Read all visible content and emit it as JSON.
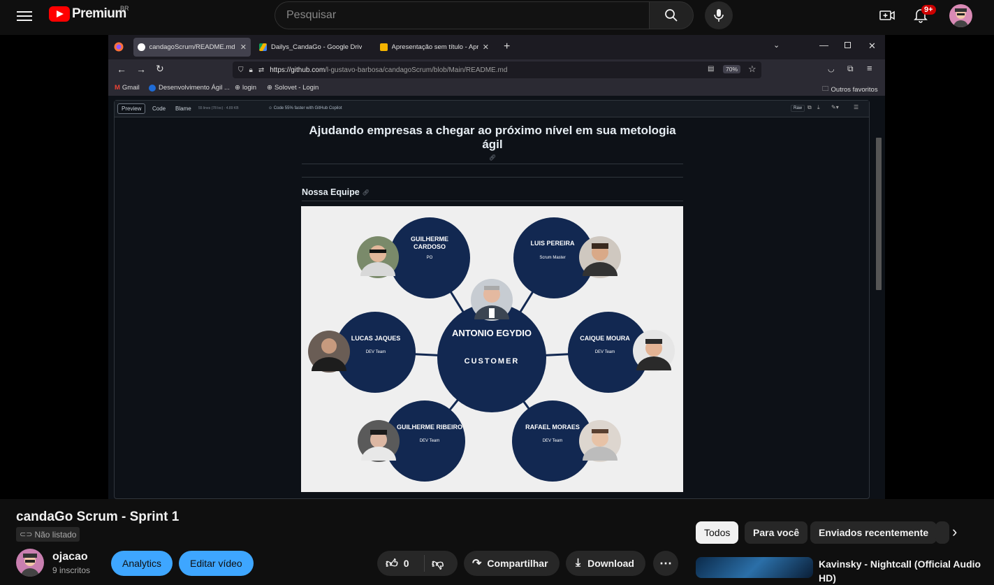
{
  "header": {
    "logo_text": "Premium",
    "region": "BR",
    "search_placeholder": "Pesquisar",
    "notifications_badge": "9+"
  },
  "browser": {
    "tabs": [
      {
        "label": "candagoScrum/README.md at"
      },
      {
        "label": "Dailys_CandaGo - Google Drive"
      },
      {
        "label": "Apresentação sem título - Apre"
      }
    ],
    "url_host": "https://github.com",
    "url_path": "/l-gustavo-barbosa/candagoScrum/blob/Main/README.md",
    "zoom": "70%",
    "bookmarks": [
      "Gmail",
      "Desenvolvimento Ágil ...",
      "login",
      "Solovet - Login"
    ],
    "other_bookmarks": "Outros favoritos"
  },
  "github": {
    "views": [
      "Preview",
      "Code",
      "Blame"
    ],
    "file_info": "55 lines (78 loc) · 4.89 KB",
    "copilot": "Code 55% faster with GitHub Copilot",
    "raw": "Raw",
    "heading": "Ajudando empresas a chegar ao próximo nível em sua metologia ágil",
    "section": "Nossa Equipe"
  },
  "team": {
    "center_name": "ANTONIO EGYDIO",
    "center_role": "CUSTOMER",
    "members": [
      {
        "name": "GUILHERME CARDOSO",
        "role": "PO"
      },
      {
        "name": "LUIS PEREIRA",
        "role": "Scrum Master"
      },
      {
        "name": "LUCAS JAQUES",
        "role": "DEV Team"
      },
      {
        "name": "CAIQUE MOURA",
        "role": "DEV Team"
      },
      {
        "name": "GUILHERME RIBEIRO",
        "role": "DEV Team"
      },
      {
        "name": "RAFAEL MORAES",
        "role": "DEV Team"
      }
    ]
  },
  "video": {
    "title": "candaGo Scrum - Sprint 1",
    "visibility": "Não listado",
    "channel": "ojacao",
    "subscribers": "9 inscritos",
    "analytics": "Analytics",
    "edit": "Editar vídeo",
    "likes": "0",
    "share": "Compartilhar",
    "download": "Download"
  },
  "sidebar": {
    "chips": [
      "Todos",
      "Para você",
      "Enviados recentemente"
    ],
    "recommended_title": "Kavinsky - Nightcall (Official Audio HD)"
  },
  "colors": {
    "brand_red": "#ff0000",
    "accent_blue": "#3ea6ff",
    "team_navy": "#122851"
  }
}
